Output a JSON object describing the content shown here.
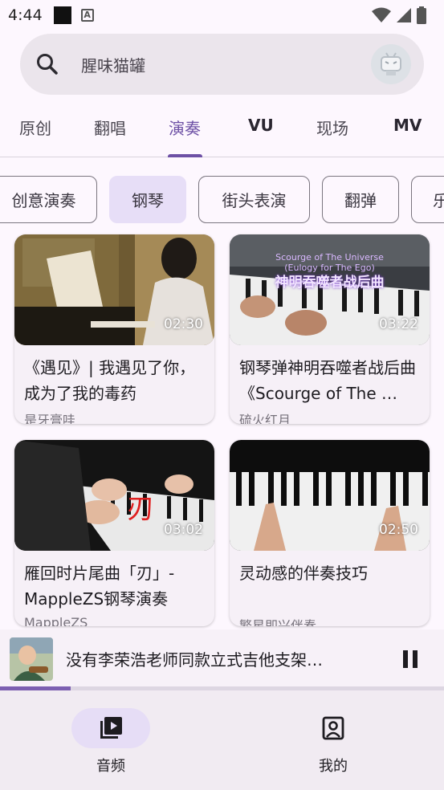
{
  "status": {
    "time": "4:44"
  },
  "search": {
    "placeholder": "腥味猫罐"
  },
  "tabs": [
    {
      "label": "原创"
    },
    {
      "label": "翻唱"
    },
    {
      "label": "演奏"
    },
    {
      "label": "VU"
    },
    {
      "label": "现场"
    },
    {
      "label": "MV"
    }
  ],
  "chips": [
    {
      "label": "创意演奏"
    },
    {
      "label": "钢琴"
    },
    {
      "label": "街头表演"
    },
    {
      "label": "翻弹"
    },
    {
      "label": "乐"
    }
  ],
  "videos": [
    {
      "title": "《遇见》| 我遇见了你，成为了我的毒药",
      "author": "是牙膏哇",
      "duration": "02:30"
    },
    {
      "title": "钢琴弹神明吞噬者战后曲《Scourge of The …",
      "author": "硫火红月",
      "duration": "03:22",
      "overlay_en": "Scourge of The Universe",
      "overlay_en2": "(Eulogy for The Ego)",
      "overlay_zh": "神明吞噬者战后曲"
    },
    {
      "title": "雁回时片尾曲「刃」- MappleZS钢琴演奏",
      "author": "MappleZS",
      "duration": "03:02",
      "overlay_zh": "刃"
    },
    {
      "title": "灵动感的伴奏技巧",
      "author": "繁星即兴伴奏",
      "duration": "02:50"
    }
  ],
  "player": {
    "title": "没有李荣浩老师同款立式吉他支架…",
    "progress": 0.16
  },
  "nav": [
    {
      "label": "音频"
    },
    {
      "label": "我的"
    }
  ],
  "colors": {
    "accent": "#6d50a5",
    "chip_selected": "#e7def7",
    "surface": "#fdf7fe"
  }
}
